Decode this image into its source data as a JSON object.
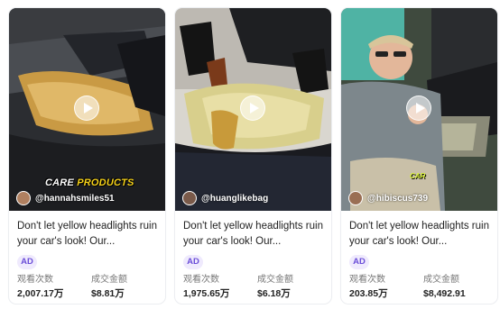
{
  "cards": [
    {
      "creator": "@hannahsmiles51",
      "title": "Don't let yellow headlights ruin your car's look! Our...",
      "badge": "AD",
      "overlay_left": "CARE",
      "overlay_right": "PRODUCTS",
      "stats": [
        {
          "label": "观看次数",
          "value": "2,007.17万"
        },
        {
          "label": "成交金额",
          "value": "$8.81万"
        }
      ]
    },
    {
      "creator": "@huanglikebag",
      "title": "Don't let yellow headlights ruin your car's look! Our...",
      "badge": "AD",
      "stats": [
        {
          "label": "观看次数",
          "value": "1,975.65万"
        },
        {
          "label": "成交金额",
          "value": "$6.18万"
        }
      ]
    },
    {
      "creator": "@hibiscus739",
      "title": "Don't let yellow headlights ruin your car's look! Our...",
      "badge": "AD",
      "overlay_badge": "CAR",
      "stats": [
        {
          "label": "观看次数",
          "value": "203.85万"
        },
        {
          "label": "成交金额",
          "value": "$8,492.91"
        }
      ]
    }
  ],
  "colors": {
    "badge_text": "#6b4ed8",
    "badge_bg": "#efeafd",
    "card_border": "#eceef1"
  }
}
